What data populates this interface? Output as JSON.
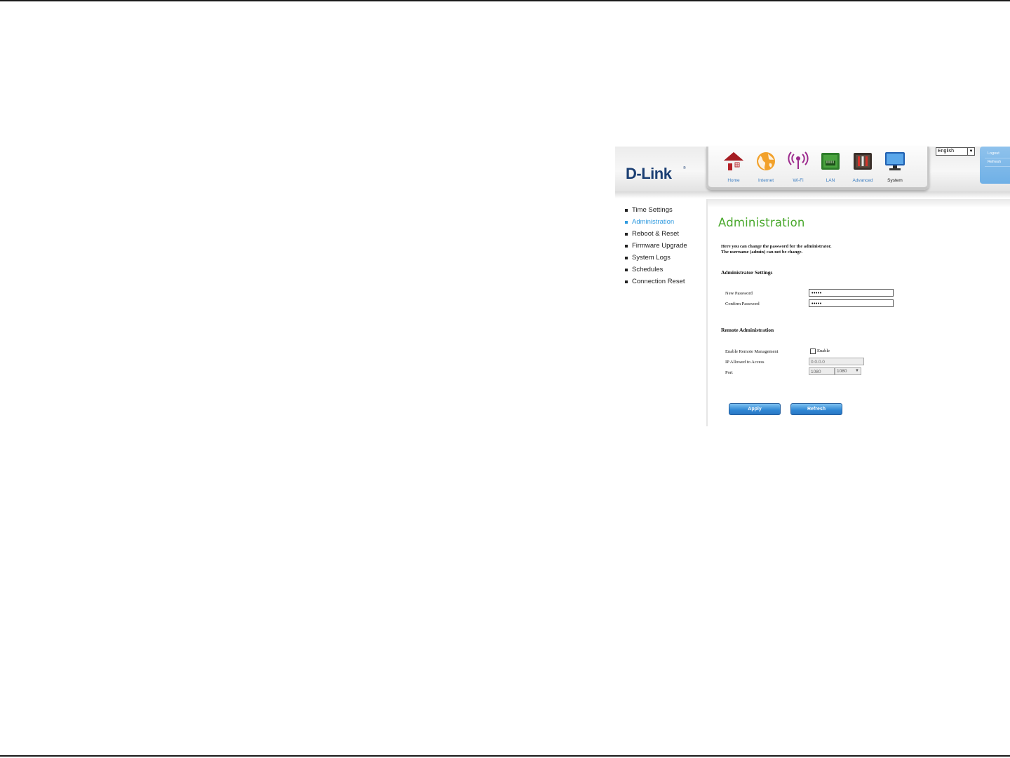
{
  "brand": {
    "logo_text": "D-Link",
    "registered_mark": "®"
  },
  "nav": {
    "items": [
      {
        "label": "Home",
        "icon": "home-icon"
      },
      {
        "label": "Internet",
        "icon": "globe-icon"
      },
      {
        "label": "Wi-Fi",
        "icon": "wifi-icon"
      },
      {
        "label": "LAN",
        "icon": "lan-icon"
      },
      {
        "label": "Advanced",
        "icon": "tools-icon"
      },
      {
        "label": "System",
        "icon": "monitor-icon"
      }
    ],
    "active": "System"
  },
  "language": {
    "selected": "English"
  },
  "account": {
    "logout": "Logout",
    "refresh": "Refresh"
  },
  "sidebar": {
    "items": [
      {
        "label": "Time Settings"
      },
      {
        "label": "Administration"
      },
      {
        "label": "Reboot & Reset"
      },
      {
        "label": "Firmware Upgrade"
      },
      {
        "label": "System Logs"
      },
      {
        "label": "Schedules"
      },
      {
        "label": "Connection Reset"
      }
    ],
    "active": "Administration"
  },
  "main": {
    "title": "Administration",
    "intro_line1": "Here you can change the password for the administrator.",
    "intro_line2": "The username (admin) can not be change.",
    "admin_settings": {
      "heading": "Administrator Settings",
      "new_password_label": "New Password",
      "new_password_value": "•••••",
      "confirm_password_label": "Confirm Password",
      "confirm_password_value": "•••••"
    },
    "remote_admin": {
      "heading": "Remote Administration",
      "enable_label": "Enable Remote Management",
      "enable_checkbox_label": "Enable",
      "enabled": false,
      "ip_label": "IP Allowed to Access",
      "ip_value": "0.0.0.0",
      "port_label": "Port",
      "port_value": "1080",
      "port_select": "1080"
    },
    "buttons": {
      "apply": "Apply",
      "refresh": "Refresh"
    }
  },
  "colors": {
    "title_green": "#49a82c",
    "link_blue": "#2f9adf",
    "logo_blue": "#1b3f73",
    "button_blue": "#2f86d3"
  }
}
